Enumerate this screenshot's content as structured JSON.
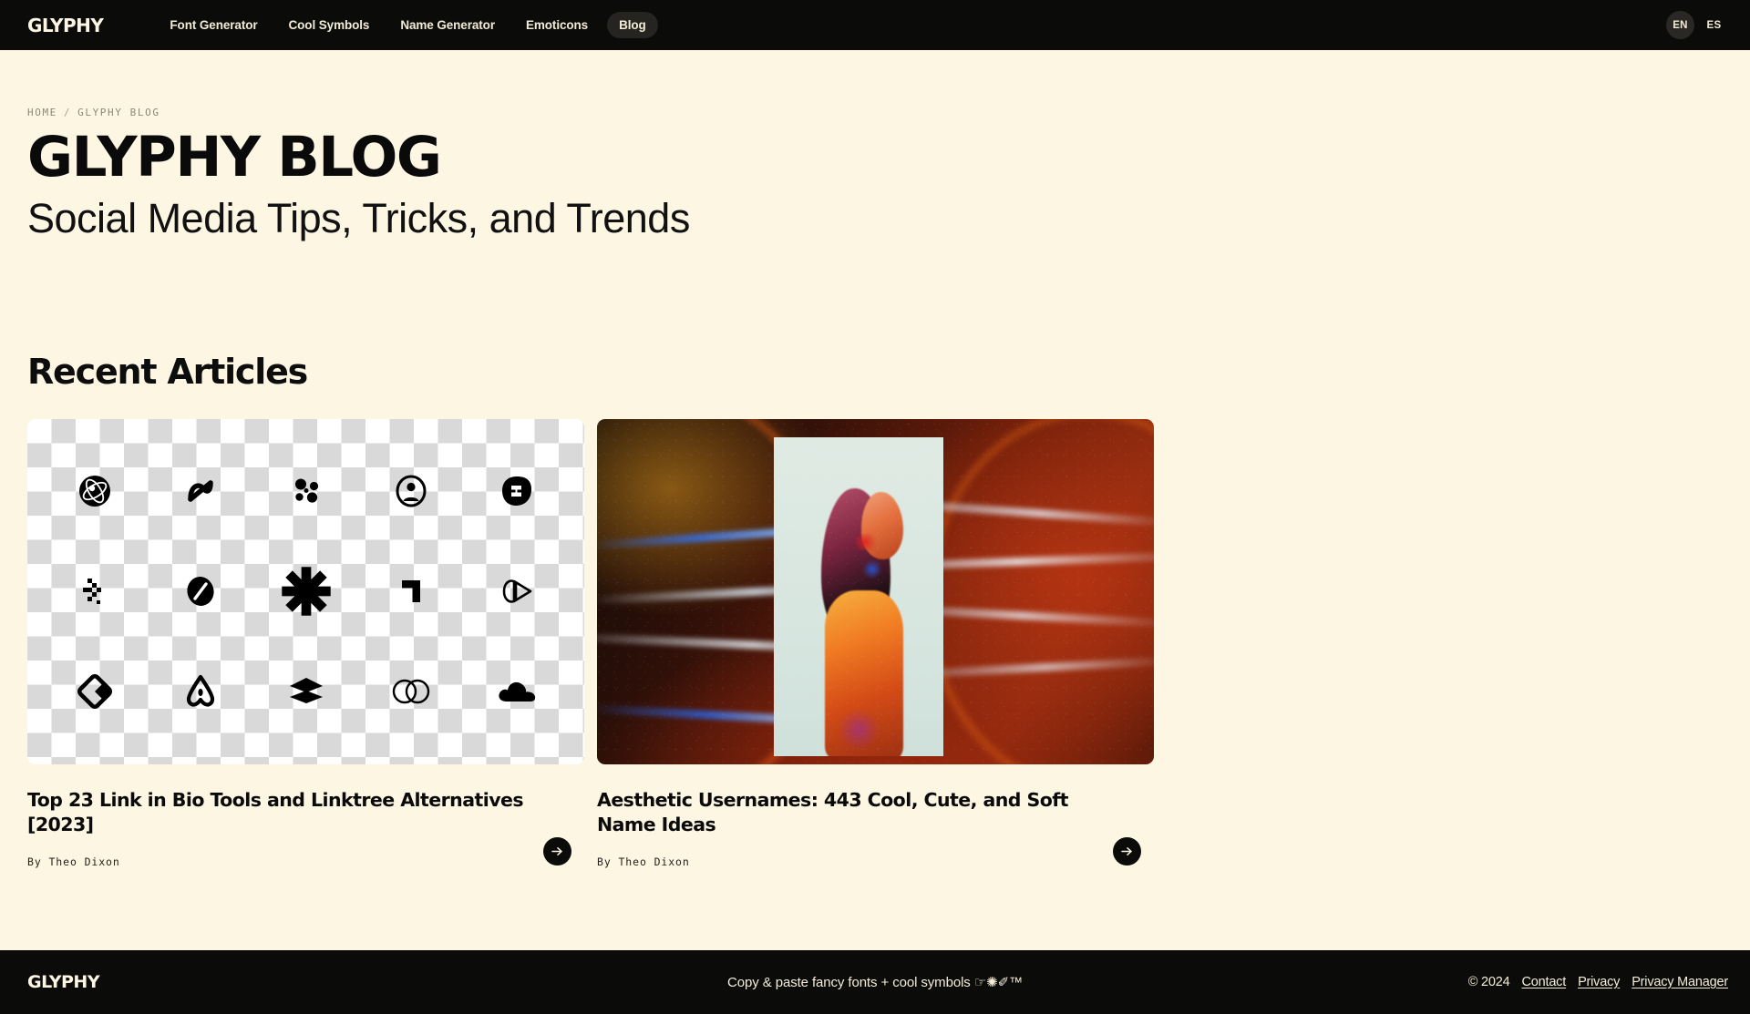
{
  "navbar": {
    "brand": "GLYPHY",
    "links": [
      {
        "label": "Font Generator",
        "active": false
      },
      {
        "label": "Cool Symbols",
        "active": false
      },
      {
        "label": "Name Generator",
        "active": false
      },
      {
        "label": "Emoticons",
        "active": false
      },
      {
        "label": "Blog",
        "active": true
      }
    ],
    "languages": [
      {
        "label": "EN",
        "active": true
      },
      {
        "label": "ES",
        "active": false
      }
    ]
  },
  "breadcrumb": {
    "home": "HOME",
    "separator": "/",
    "current": "GLYPHY BLOG"
  },
  "hero": {
    "title": "GLYPHY BLOG",
    "subtitle": "Social Media Tips, Tricks, and Trends"
  },
  "section": {
    "heading": "Recent Articles"
  },
  "articles": [
    {
      "title": "Top 23 Link in Bio Tools and Linktree Alternatives [2023]",
      "author": "By Theo Dixon",
      "media": "checkerboard-icon-sheet",
      "arrow": "→"
    },
    {
      "title": "Aesthetic Usernames: 443 Cool, Cute, and Soft Name Ideas",
      "author": "By Theo Dixon",
      "media": "glitch-art-portrait",
      "arrow": "→"
    }
  ],
  "footer": {
    "brand": "GLYPHY",
    "tagline": "Copy & paste fancy fonts + cool symbols ☞✺✐™",
    "copyright": "© 2024",
    "links": [
      {
        "label": "Contact"
      },
      {
        "label": "Privacy"
      },
      {
        "label": "Privacy Manager"
      }
    ]
  },
  "colors": {
    "background": "#FDF6E3",
    "ink": "#0B0B09",
    "cream": "#F4EDDA",
    "muted": "#8D8877"
  }
}
